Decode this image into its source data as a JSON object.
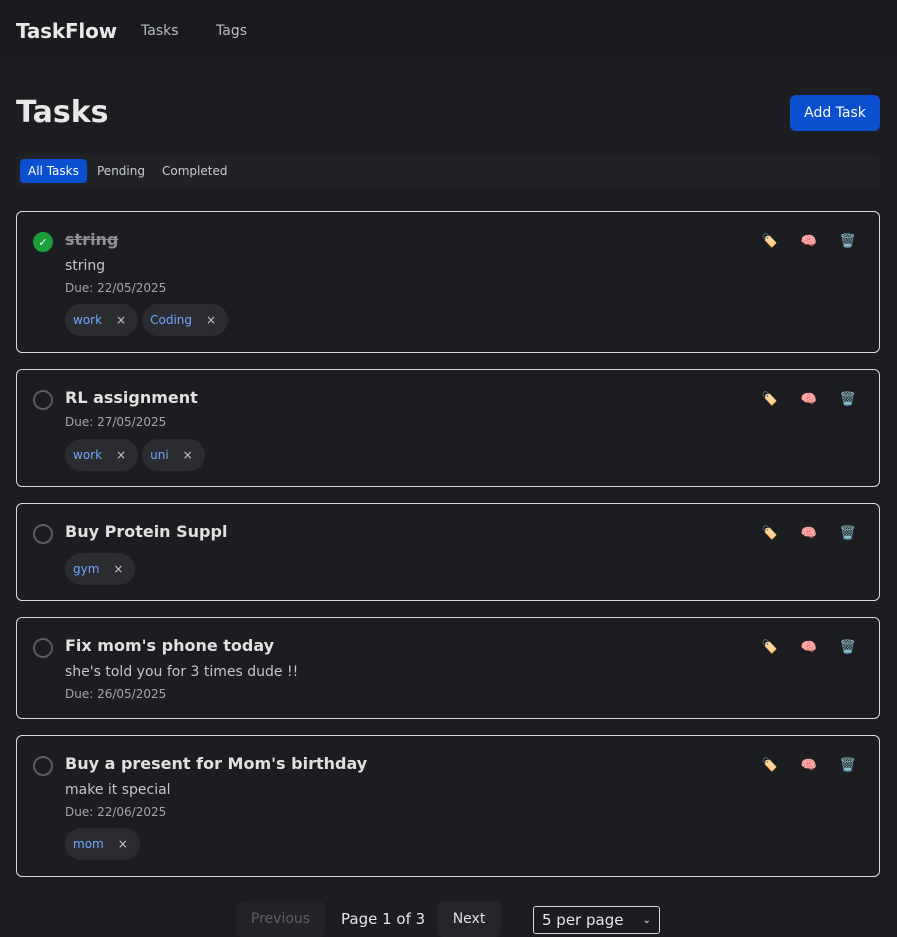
{
  "app": {
    "name": "TaskFlow"
  },
  "nav": {
    "items": [
      {
        "label": "Tasks"
      },
      {
        "label": "Tags"
      }
    ]
  },
  "page": {
    "title": "Tasks",
    "add_label": "Add Task"
  },
  "filters": {
    "tabs": [
      {
        "label": "All Tasks",
        "active": true
      },
      {
        "label": "Pending"
      },
      {
        "label": "Completed"
      }
    ]
  },
  "actions": {
    "tag_icon": "🏷️",
    "ai_icon": "🧠",
    "delete_icon": "🗑️"
  },
  "check_mark": "✓",
  "tag_remove": "×",
  "tasks": [
    {
      "title": "string",
      "completed": true,
      "description": "string",
      "due": "Due: 22/05/2025",
      "tags": [
        {
          "name": "work"
        },
        {
          "name": "Coding"
        }
      ]
    },
    {
      "title": "RL assignment",
      "completed": false,
      "due": "Due: 27/05/2025",
      "tags": [
        {
          "name": "work"
        },
        {
          "name": "uni"
        }
      ]
    },
    {
      "title": "Buy Protein Suppl",
      "completed": false,
      "tags": [
        {
          "name": "gym"
        }
      ]
    },
    {
      "title": "Fix mom's phone today",
      "completed": false,
      "description": "she's told you for 3 times dude !!",
      "due": "Due: 26/05/2025",
      "tags": []
    },
    {
      "title": "Buy a present for Mom's birthday",
      "completed": false,
      "description": "make it special",
      "due": "Due: 22/06/2025",
      "tags": [
        {
          "name": "mom"
        }
      ]
    }
  ],
  "pagination": {
    "previous_label": "Previous",
    "next_label": "Next",
    "page_info": "Page 1 of 3",
    "per_page": "5 per page",
    "chevron": "⌄"
  },
  "colors": {
    "accent": "#0b4fd1",
    "done": "#1a9e3c",
    "tag_text": "#6ea8ff",
    "card_border": "#d9d9d9"
  }
}
